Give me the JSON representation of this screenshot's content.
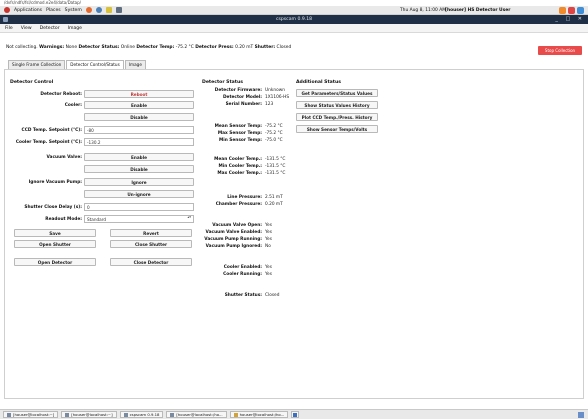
{
  "url_strip": "/dvfs/ndfs/fsl/cdmod.e2e4/data/Datap/",
  "top_panel": {
    "applications": "Applications",
    "places": "Places",
    "system": "System",
    "clock": "Thu Aug 8, 11:00 AM",
    "user": "[houser] HS Detector User"
  },
  "window": {
    "title": "cspscam 0.9.18"
  },
  "menu": [
    "File",
    "View",
    "Detector",
    "Image"
  ],
  "status": {
    "prefix": "Not collecting.",
    "warnings_label": "Warnings:",
    "warnings_value": "None",
    "detector_status_label": "Detector Status:",
    "detector_status_value": "Online",
    "detector_temp_label": "Detector Temp:",
    "detector_temp_value": "-75.2 °C",
    "detector_press_label": "Detector Press:",
    "detector_press_value": "0.20 mT",
    "shutter_label": "Shutter:",
    "shutter_value": "Closed"
  },
  "stop_button": "Stop Collection",
  "tabs": [
    "Single Frame Collection",
    "Detector Control/Status",
    "Image"
  ],
  "detector_control": {
    "title": "Detector Control",
    "reboot_label": "Detector Reboot:",
    "reboot_button": "Reboot",
    "cooler_label": "Cooler:",
    "cooler_enable": "Enable",
    "cooler_disable": "Disable",
    "ccd_setpoint_label": "CCD Temp. Setpoint (°C):",
    "ccd_setpoint_value": "-80",
    "cooler_setpoint_label": "Cooler Temp. Setpoint (°C):",
    "cooler_setpoint_value": "-130.2",
    "vacuum_valve_label": "Vacuum Valve:",
    "vacuum_enable": "Enable",
    "vacuum_disable": "Disable",
    "ignore_pump_label": "Ignore Vacuum Pump:",
    "ignore_button": "Ignore",
    "unignore_button": "Un-ignore",
    "shutter_delay_label": "Shutter Close Delay (s):",
    "shutter_delay_value": "0",
    "readout_mode_label": "Readout Mode:",
    "readout_mode_value": "Standard",
    "save_button": "Save",
    "revert_button": "Revert",
    "open_shutter_button": "Open Shutter",
    "close_shutter_button": "Close Shutter",
    "open_detector_button": "Open Detector",
    "close_detector_button": "Close Detector"
  },
  "detector_status": {
    "title": "Detector Status",
    "rows": [
      {
        "label": "Detector Firmware:",
        "value": "Unknown"
      },
      {
        "label": "Detector Model:",
        "value": "1X1106-HS"
      },
      {
        "label": "Serial Number:",
        "value": "123"
      },
      {
        "label": "Mean Sensor Temp:",
        "value": "-75.2 °C"
      },
      {
        "label": "Max Sensor Temp:",
        "value": "-75.2 °C"
      },
      {
        "label": "Min Sensor Temp:",
        "value": "-75.0 °C"
      },
      {
        "label": "Mean Cooler Temp.:",
        "value": "-131.5 °C"
      },
      {
        "label": "Min Cooler Temp.:",
        "value": "-131.5 °C"
      },
      {
        "label": "Max Cooler Temp.:",
        "value": "-131.5 °C"
      },
      {
        "label": "Line Pressure:",
        "value": "2.51 mT"
      },
      {
        "label": "Chamber Pressure:",
        "value": "0.20 mT"
      },
      {
        "label": "Vacuum Valve Open:",
        "value": "Yes"
      },
      {
        "label": "Vacuum Valve Enabled:",
        "value": "Yes"
      },
      {
        "label": "Vacuum Pump Running:",
        "value": "Yes"
      },
      {
        "label": "Vacuum Pump Ignored:",
        "value": "No"
      },
      {
        "label": "Cooler Enabled:",
        "value": "Yes"
      },
      {
        "label": "Cooler Running:",
        "value": "Yes"
      },
      {
        "label": "Shutter Status:",
        "value": "Closed"
      }
    ]
  },
  "additional_status": {
    "title": "Additional Status",
    "buttons": [
      "Get Parameters/Status Values",
      "Show Status Values History",
      "Plot CCD Temp./Press. History",
      "Show Sensor Temps/Volts"
    ]
  },
  "taskbar": [
    "[houser@localhost:~]",
    "[houser@localhost:~]",
    "cspscam 0.9.18",
    "[houser@localhost:/ho...",
    "houser@localhost:/ho..."
  ],
  "colors": {
    "title_bar": "#1f2f45",
    "stop_button": "#e94a4a",
    "reboot_text": "#c23a3a"
  }
}
